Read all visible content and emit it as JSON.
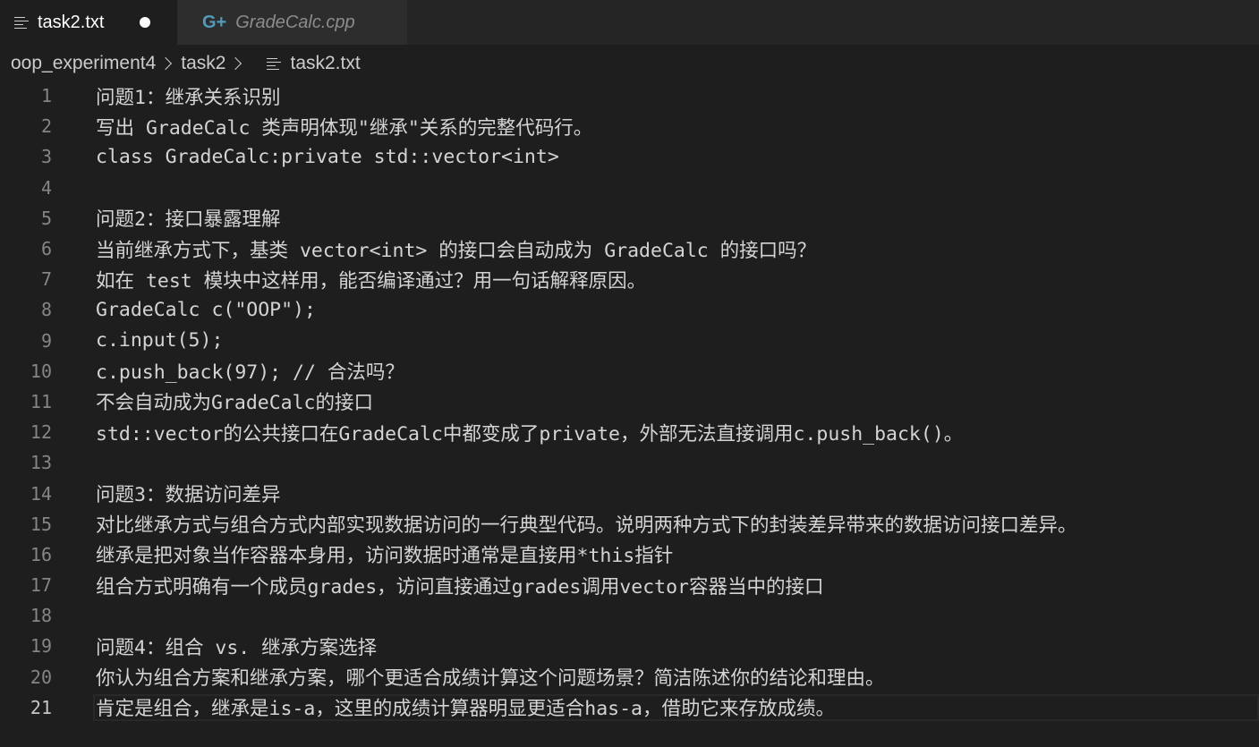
{
  "tabs": [
    {
      "label": "task2.txt",
      "active": true,
      "modified": true,
      "icon": "text-file-icon"
    },
    {
      "label": "GradeCalc.cpp",
      "active": false,
      "icon": "cpp-file-icon"
    }
  ],
  "breadcrumb": [
    "oop_experiment4",
    "task2",
    "task2.txt"
  ],
  "editor": {
    "current_line": 21,
    "lines": [
      {
        "num": "1",
        "text": "问题1：继承关系识别"
      },
      {
        "num": "2",
        "text": "写出 GradeCalc 类声明体现\"继承\"关系的完整代码行。"
      },
      {
        "num": "3",
        "text": "class GradeCalc:private std::vector<int>"
      },
      {
        "num": "4",
        "text": ""
      },
      {
        "num": "5",
        "text": "问题2：接口暴露理解"
      },
      {
        "num": "6",
        "text": "当前继承方式下，基类 vector<int> 的接口会自动成为 GradeCalc 的接口吗？"
      },
      {
        "num": "7",
        "text": "如在 test 模块中这样用，能否编译通过？用一句话解释原因。"
      },
      {
        "num": "8",
        "text": "GradeCalc c(\"OOP\");"
      },
      {
        "num": "9",
        "text": "c.input(5);"
      },
      {
        "num": "10",
        "text": "c.push_back(97); // 合法吗？"
      },
      {
        "num": "11",
        "text": "不会自动成为GradeCalc的接口"
      },
      {
        "num": "12",
        "text": "std::vector的公共接口在GradeCalc中都变成了private，外部无法直接调用c.push_back()。"
      },
      {
        "num": "13",
        "text": ""
      },
      {
        "num": "14",
        "text": "问题3：数据访问差异"
      },
      {
        "num": "15",
        "text": "对比继承方式与组合方式内部实现数据访问的一行典型代码。说明两种方式下的封装差异带来的数据访问接口差异。"
      },
      {
        "num": "16",
        "text": "继承是把对象当作容器本身用，访问数据时通常是直接用*this指针"
      },
      {
        "num": "17",
        "text": "组合方式明确有一个成员grades，访问直接通过grades调用vector容器当中的接口"
      },
      {
        "num": "18",
        "text": ""
      },
      {
        "num": "19",
        "text": "问题4：组合 vs. 继承方案选择"
      },
      {
        "num": "20",
        "text": "你认为组合方案和继承方案，哪个更适合成绩计算这个问题场景？简洁陈述你的结论和理由。"
      },
      {
        "num": "21",
        "text": "肯定是组合，继承是is-a，这里的成绩计算器明显更适合has-a，借助它来存放成绩。"
      }
    ]
  }
}
